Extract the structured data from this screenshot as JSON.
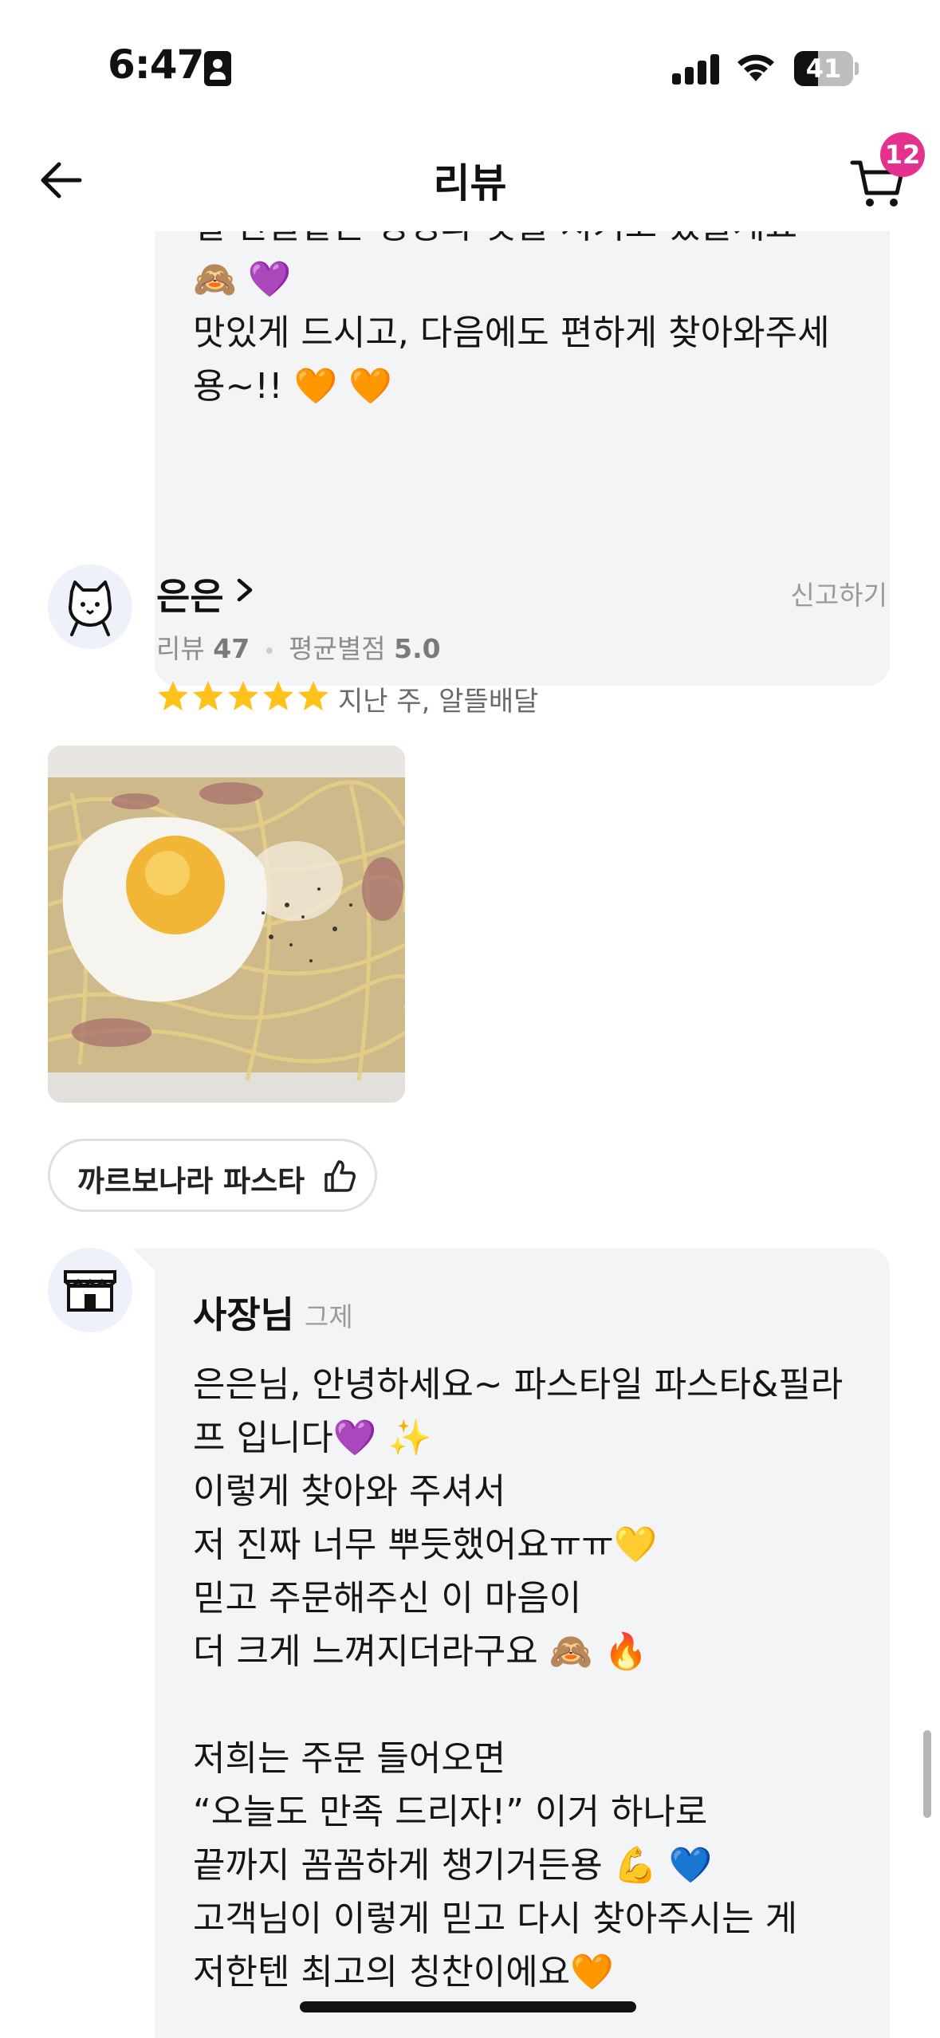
{
  "status_bar": {
    "time": "6:47",
    "battery_level": "41",
    "battery_fraction": 0.41
  },
  "header": {
    "title": "리뷰",
    "cart_count": "12",
    "accent_color": "#e5318e"
  },
  "previous_reply": {
    "text": "걸 한끌같은 정성과 맛을 지키고 있을게요\n🙈 💜\n맛있게 드시고, 다음에도 편하게 찾아와주세\n용~!! 🧡 🧡"
  },
  "review": {
    "reviewer_name": "은은",
    "report_label": "신고하기",
    "stats": {
      "review_label": "리뷰",
      "review_count": "47",
      "avg_label": "평균별점",
      "avg_rating": "5.0"
    },
    "rating": 5,
    "meta": "지난 주, 알뜰배달",
    "photo_desc_icon": "carbonara-pasta-photo",
    "menu_chip": "까르보나라 파스타"
  },
  "owner_reply": {
    "name": "사장님",
    "time": "그제",
    "text": "은은님, 안녕하세요~ 파스타일 파스타&필라\n프 입니다💜 ✨\n이렇게 찾아와 주셔서\n저 진짜 너무 뿌듯했어요ㅠㅠ💛\n믿고 주문해주신 이 마음이\n더 크게 느껴지더라구요 🙈 🔥\n\n저희는 주문 들어오면\n“오늘도 만족 드리자!” 이거 하나로\n끝까지 꼼꼼하게 챙기거든용 💪 💙\n고객님이 이렇게 믿고 다시 찾아주시는 게\n저한텐 최고의 칭찬이에요🧡"
  },
  "colors": {
    "star": "#ffc21c",
    "bubble_bg": "#f3f4f6"
  }
}
